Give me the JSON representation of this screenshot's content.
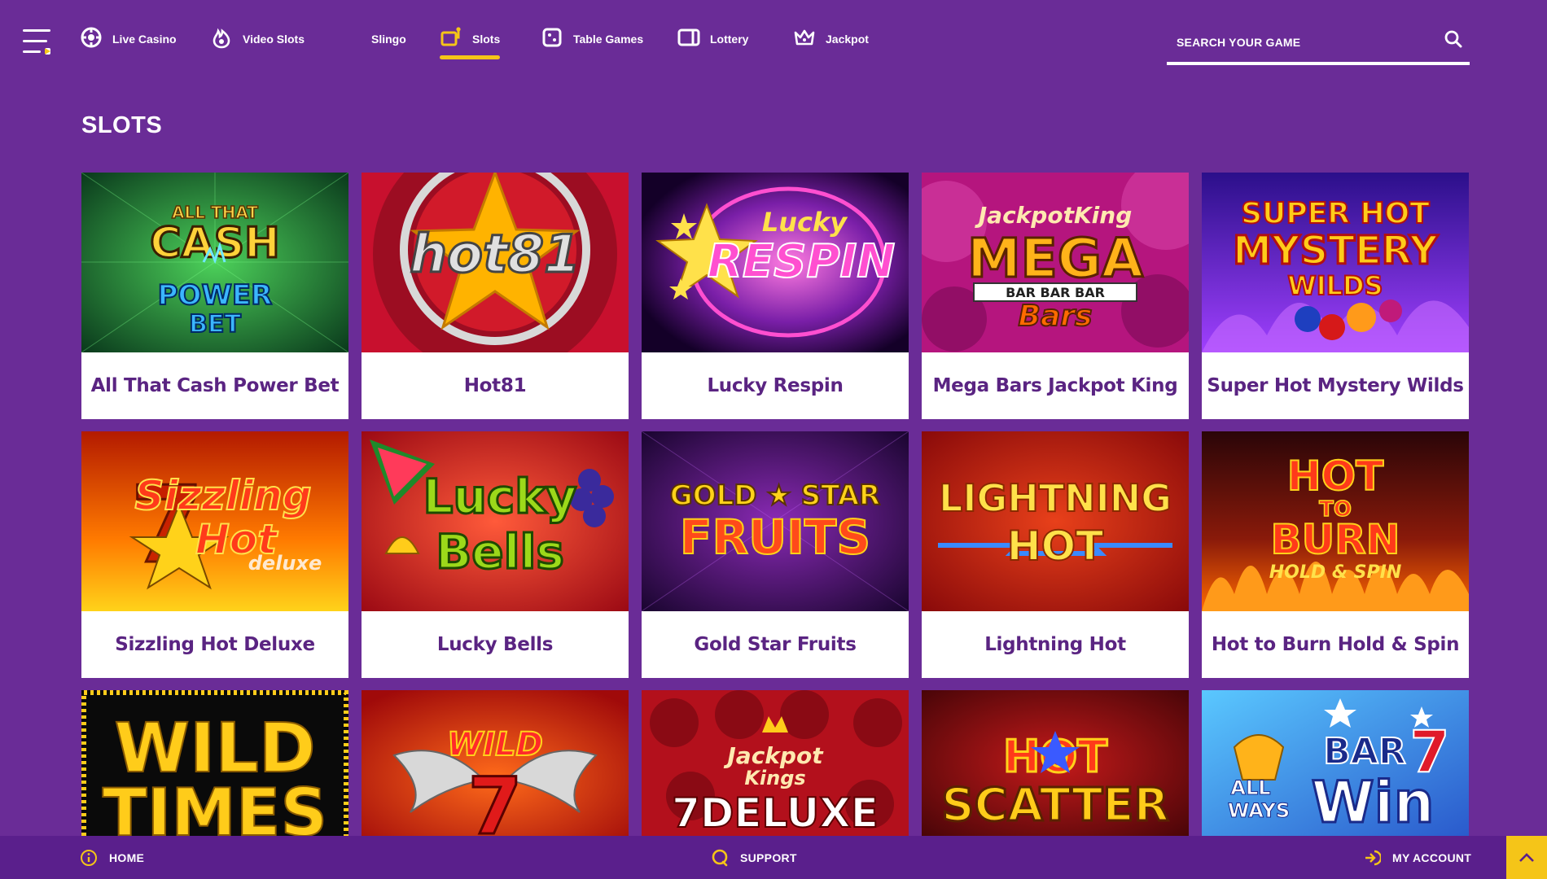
{
  "nav": {
    "items": [
      {
        "label": "Live Casino",
        "icon": "roulette-chip-icon"
      },
      {
        "label": "Video Slots",
        "icon": "flame-icon"
      },
      {
        "label": "Slingo",
        "icon": ""
      },
      {
        "label": "Slots",
        "icon": "slot-machine-icon",
        "active": true
      },
      {
        "label": "Table Games",
        "icon": "dice-icon"
      },
      {
        "label": "Lottery",
        "icon": "ticket-icon"
      },
      {
        "label": "Jackpot",
        "icon": "crown-icon"
      }
    ],
    "search_placeholder": "SEARCH YOUR GAME"
  },
  "page": {
    "title": "SLOTS"
  },
  "games": [
    {
      "name": "All That Cash Power Bet",
      "art": "ALL THAT CASH POWER BET"
    },
    {
      "name": "Hot81",
      "art": "hot81"
    },
    {
      "name": "Lucky Respin",
      "art": "Lucky RESPIN"
    },
    {
      "name": "Mega Bars Jackpot King",
      "art": "JackpotKing MEGA BAR BAR BAR Bars"
    },
    {
      "name": "Super Hot Mystery Wilds",
      "art": "SUPER HOT MYSTERY WILDS"
    },
    {
      "name": "Sizzling Hot Deluxe",
      "art": "Sizzling Hot deluxe"
    },
    {
      "name": "Lucky Bells",
      "art": "Lucky Bells"
    },
    {
      "name": "Gold Star Fruits",
      "art": "GOLD STAR FRUITS"
    },
    {
      "name": "Lightning Hot",
      "art": "LIGHTNING HOT"
    },
    {
      "name": "Hot to Burn Hold & Spin",
      "art": "HOT TO BURN HOLD & SPIN"
    },
    {
      "name": "",
      "art": "WILD TIMES"
    },
    {
      "name": "",
      "art": "WILD 7"
    },
    {
      "name": "",
      "art": "Jackpot Kings 7 DELUXE"
    },
    {
      "name": "",
      "art": "HOT SCATTER"
    },
    {
      "name": "",
      "art": "ALL WAYS BAR 7 Win"
    }
  ],
  "bottom_bar": {
    "home": "HOME",
    "support": "SUPPORT",
    "account": "MY ACCOUNT"
  },
  "colors": {
    "background": "#6a2c97",
    "accent": "#f5c518",
    "card_text": "#5a2482",
    "bottom_bar": "#5a1f8c"
  }
}
